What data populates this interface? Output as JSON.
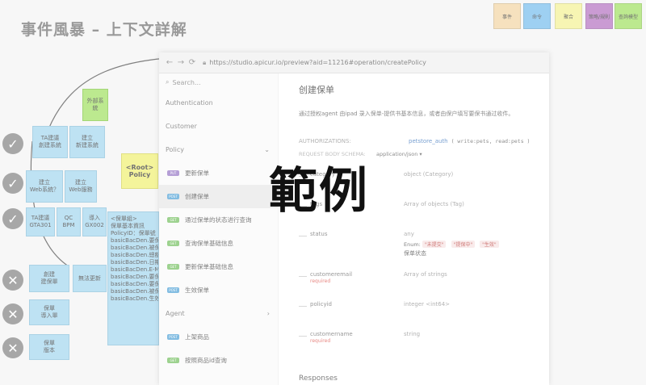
{
  "board": {
    "title": "事件風暴 – 上下文詳解",
    "legend": [
      {
        "label": "事件",
        "color": "#f3d7a8"
      },
      {
        "label": "命令",
        "color": "#7ec0ee"
      },
      {
        "label": "聚合",
        "color": "#f4f29a"
      },
      {
        "label": "策略/規則",
        "color": "#b97ac4"
      },
      {
        "label": "查詢模型",
        "color": "#a6e26a"
      }
    ],
    "sticky_external": "外部系統",
    "sticky_root": "<Root>\nPolicy",
    "stickies_left": [
      {
        "text": "TA建議\n創建系統"
      },
      {
        "text": "建立\n新建系統"
      },
      {
        "text": "建立\nWeb系統？"
      },
      {
        "text": "建立\nWeb服務"
      },
      {
        "text": "TA建議\nGTA301"
      },
      {
        "text": "QC\nBPM"
      },
      {
        "text": "導入\nGX002"
      },
      {
        "text": "創建\n建保單"
      },
      {
        "text": "無法更新"
      },
      {
        "text": "保單\n導入單"
      },
      {
        "text": "保單\n版本"
      }
    ],
    "aggregate_lines": [
      "<保單組>",
      "保單基本資訊",
      "PolicyID：保單號",
      "basicBacDen.要保",
      "basicBacDen.被保",
      "basicBacDen.總額",
      "basicBacDen.日期",
      "basicBacDen.E-Mail",
      "basicBacDen.要保",
      "basicBacDen.要保",
      "basicBacDen.被保",
      "basicBacDen.生效"
    ],
    "status_icons": [
      "check",
      "check",
      "check",
      "cross",
      "cross",
      "cross"
    ]
  },
  "browser": {
    "url": "https://studio.apicur.io/preview?aid=11216#operation/createPolicy",
    "search_placeholder": "Search...",
    "sections": {
      "authentication": "Authentication",
      "customer": "Customer",
      "policy": "Policy",
      "agent": "Agent"
    },
    "operations": [
      {
        "method": "PUT",
        "label": "更新保单",
        "active": false
      },
      {
        "method": "POST",
        "label": "创建保单",
        "active": true
      },
      {
        "method": "GET",
        "label": "通过保单的状态进行查询",
        "active": false
      },
      {
        "method": "GET",
        "label": "查询保单基础信息",
        "active": false
      },
      {
        "method": "GET",
        "label": "更新保单基础信息",
        "active": false
      },
      {
        "method": "POST",
        "label": "生效保单",
        "active": false
      }
    ],
    "agent_ops": [
      {
        "method": "POST",
        "label": "上架商品"
      },
      {
        "method": "GET",
        "label": "按照商品id查询"
      }
    ],
    "detail": {
      "title": "创建保单",
      "description": "通过授权agent 由ipad 录入保单-提供书基本信息，或者由保户填写要保书通过收件。",
      "auth_key": "AUTHORIZATIONS:",
      "auth_value": "petstore_auth",
      "auth_scopes": "( write:pets, read:pets )",
      "schema_key": "REQUEST BODY SCHEMA:",
      "schema_value": "application/json ▾",
      "properties": [
        {
          "name": "category",
          "required": "",
          "type": "object (Category)"
        },
        {
          "name": "tags",
          "required": "",
          "type": "Array of objects (Tag)"
        },
        {
          "name": "status",
          "required": "",
          "type": "any"
        },
        {
          "name": "customeremail",
          "required": "required",
          "type": "Array of strings"
        },
        {
          "name": "policyid",
          "required": "",
          "type": "integer <int64>"
        },
        {
          "name": "customername",
          "required": "required",
          "type": "string"
        }
      ],
      "enum_label": "Enum:",
      "enum_values": [
        "\"未提交\"",
        "\"提保中\"",
        "\"生效\""
      ],
      "status_desc": "保单状态",
      "responses": "Responses"
    }
  },
  "watermark": "範例"
}
